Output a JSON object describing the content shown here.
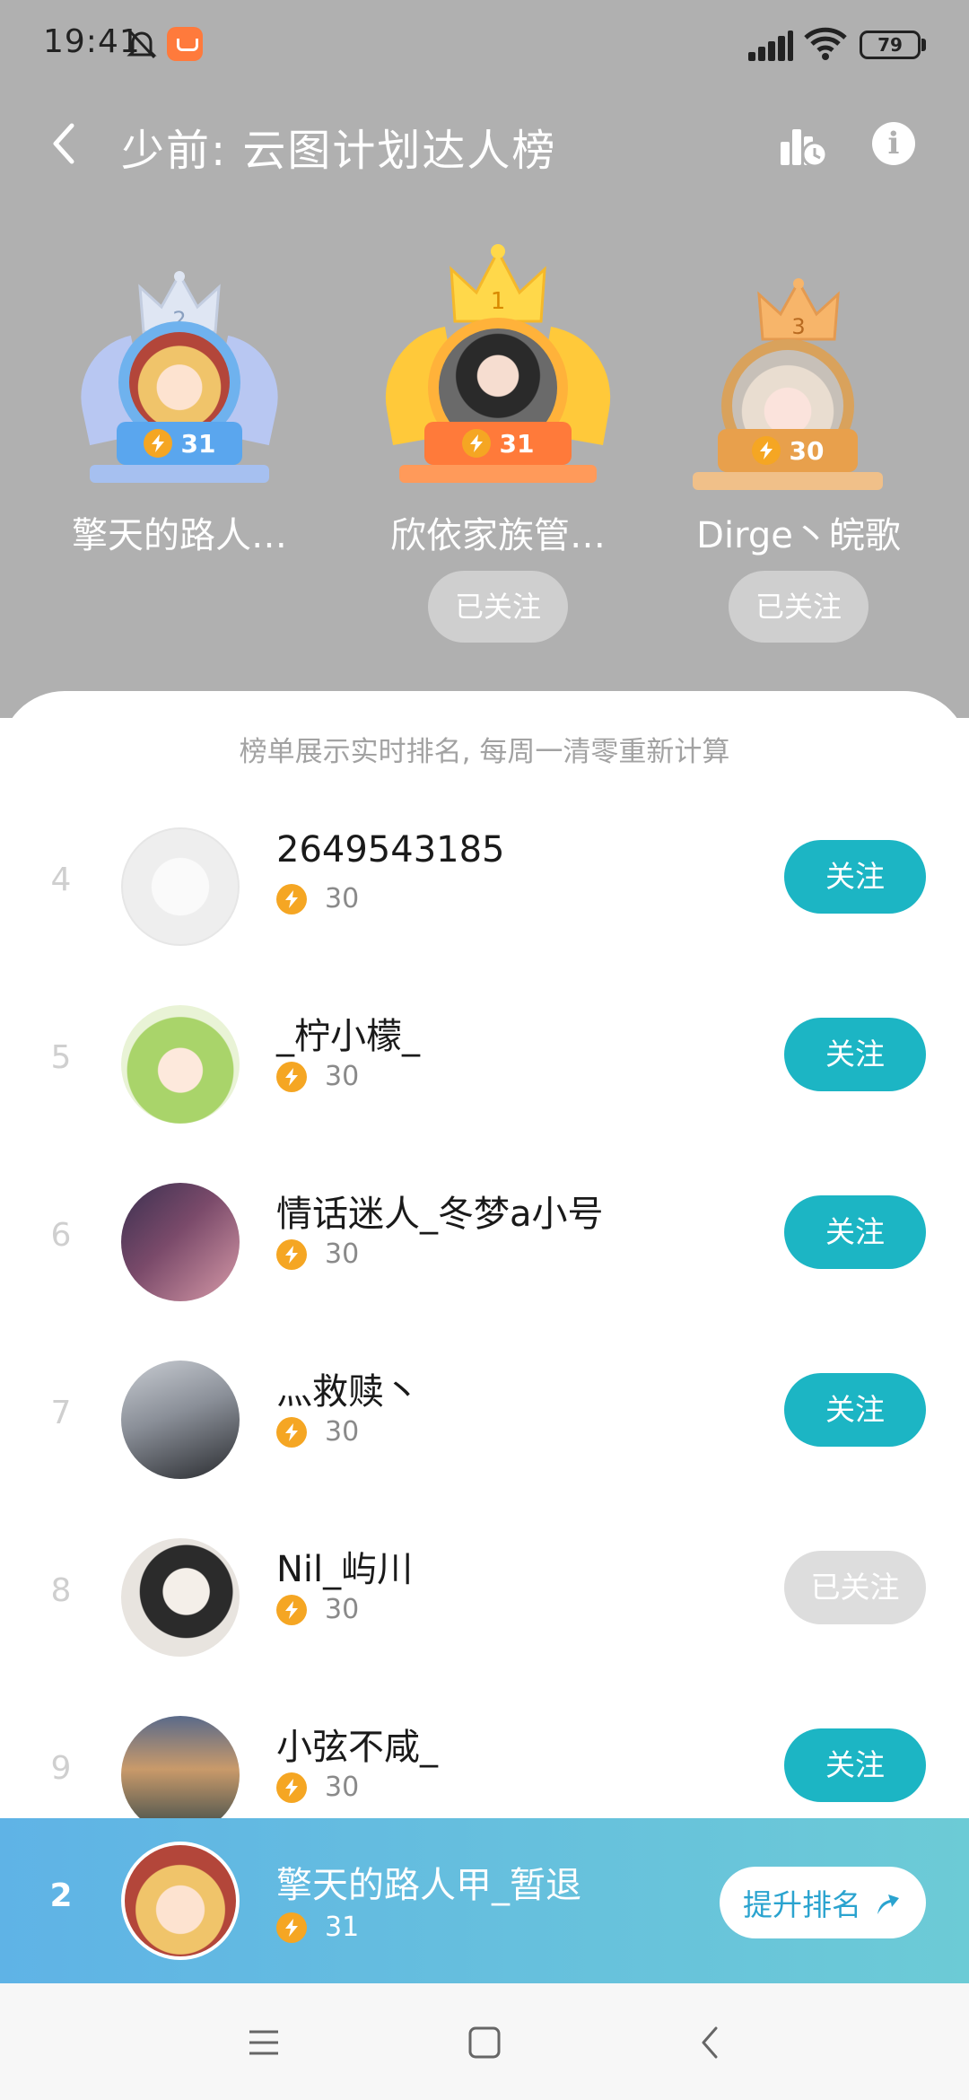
{
  "status": {
    "time": "19:41",
    "battery": "79"
  },
  "header": {
    "title": "少前: 云图计划达人榜"
  },
  "podium": [
    {
      "place": "2",
      "name": "擎天的路人…",
      "score": "31",
      "follow": ""
    },
    {
      "place": "1",
      "name": "欣依家族管…",
      "score": "31",
      "follow": "已关注"
    },
    {
      "place": "3",
      "name": "Dirge丶皖歌",
      "score": "30",
      "follow": "已关注"
    }
  ],
  "notice": "榜单展示实时排名, 每周一清零重新计算",
  "list": [
    {
      "rank": "4",
      "name": "2649543185",
      "score": "30",
      "button": "关注",
      "followed": false
    },
    {
      "rank": "5",
      "name": "_柠小檬_",
      "score": "30",
      "button": "关注",
      "followed": false
    },
    {
      "rank": "6",
      "name": "情话迷人_冬梦a小号",
      "score": "30",
      "button": "关注",
      "followed": false
    },
    {
      "rank": "7",
      "name": "灬救赎丶",
      "score": "30",
      "button": "关注",
      "followed": false
    },
    {
      "rank": "8",
      "name": "Nil_屿川",
      "score": "30",
      "button": "已关注",
      "followed": true
    },
    {
      "rank": "9",
      "name": "小弦不咸_",
      "score": "30",
      "button": "关注",
      "followed": false
    }
  ],
  "me": {
    "rank": "2",
    "name": "擎天的路人甲_暂退",
    "score": "31",
    "button": "提升排名"
  },
  "colors": {
    "accent": "#1cb5c4",
    "score": "#f5a623",
    "header_bg": "#b0b0b0"
  }
}
